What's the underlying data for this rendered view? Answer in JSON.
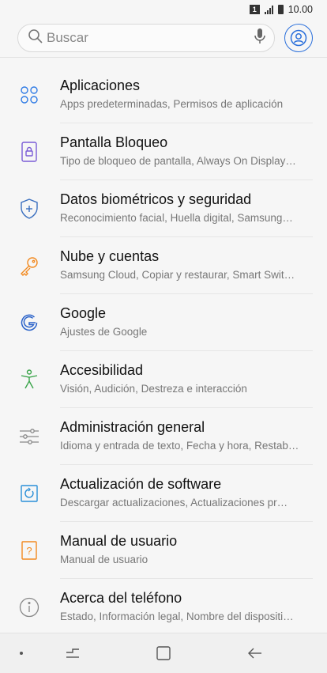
{
  "status_bar": {
    "sim": "1",
    "time": "10.00"
  },
  "search": {
    "placeholder": "Buscar"
  },
  "settings": [
    {
      "title": "Aplicaciones",
      "subtitle": "Apps predeterminadas, Permisos de aplicación",
      "icon": "apps-icon",
      "color": "#2f7be5"
    },
    {
      "title": "Pantalla Bloqueo",
      "subtitle": "Tipo de bloqueo de pantalla, Always On Display…",
      "icon": "lock-icon",
      "color": "#7a5cd6"
    },
    {
      "title": "Datos biométricos y seguridad",
      "subtitle": "Reconocimiento facial, Huella digital, Samsung…",
      "icon": "shield-icon",
      "color": "#3a6fbf"
    },
    {
      "title": "Nube y cuentas",
      "subtitle": "Samsung Cloud, Copiar y restaurar, Smart Swit…",
      "icon": "key-icon",
      "color": "#f28a20"
    },
    {
      "title": "Google",
      "subtitle": "Ajustes de Google",
      "icon": "google-icon",
      "color": "#2a62c9"
    },
    {
      "title": "Accesibilidad",
      "subtitle": "Visión, Audición, Destreza e interacción",
      "icon": "accessibility-icon",
      "color": "#3aa44a"
    },
    {
      "title": "Administración general",
      "subtitle": "Idioma y entrada de texto, Fecha y hora, Restab…",
      "icon": "sliders-icon",
      "color": "#888888"
    },
    {
      "title": "Actualización de software",
      "subtitle": "Descargar actualizaciones, Actualizaciones pr…",
      "icon": "software-update-icon",
      "color": "#2a8fd8"
    },
    {
      "title": "Manual de usuario",
      "subtitle": "Manual de usuario",
      "icon": "manual-icon",
      "color": "#f28a20"
    },
    {
      "title": "Acerca del teléfono",
      "subtitle": "Estado, Información legal, Nombre del dispositi…",
      "icon": "info-icon",
      "color": "#888888"
    }
  ]
}
